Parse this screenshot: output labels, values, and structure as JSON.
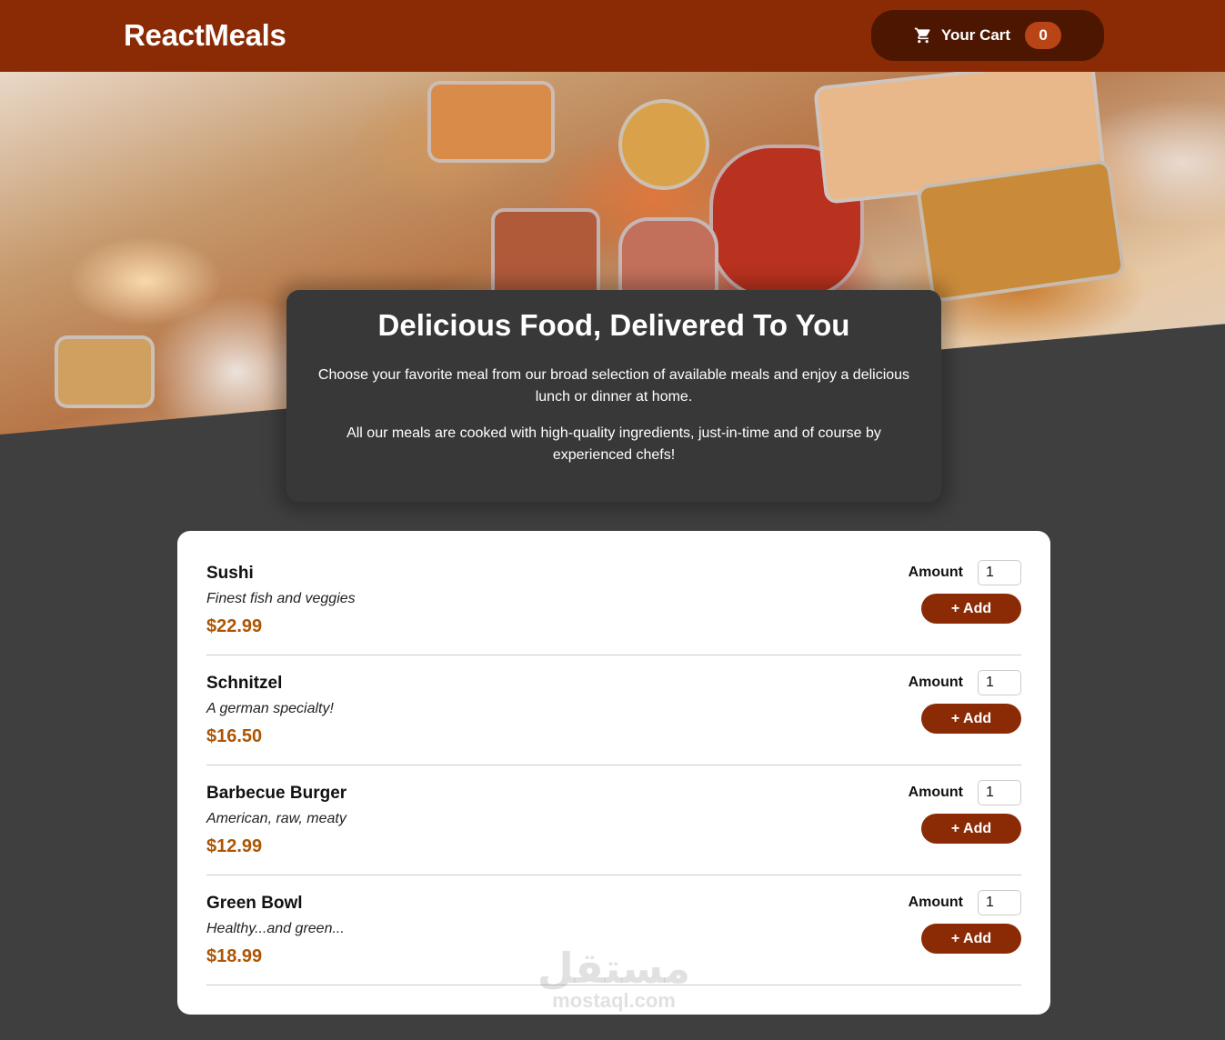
{
  "header": {
    "brand": "ReactMeals",
    "cart_label": "Your Cart",
    "cart_count": "0",
    "cart_icon": "cart-icon"
  },
  "summary": {
    "title": "Delicious Food, Delivered To You",
    "paragraph1": "Choose your favorite meal from our broad selection of available meals and enjoy a delicious lunch or dinner at home.",
    "paragraph2": "All our meals are cooked with high-quality ingredients, just-in-time and of course by experienced chefs!"
  },
  "meals": {
    "amount_label": "Amount",
    "add_label": "+ Add",
    "items": [
      {
        "name": "Sushi",
        "description": "Finest fish and veggies",
        "price": "$22.99",
        "amount": "1"
      },
      {
        "name": "Schnitzel",
        "description": "A german specialty!",
        "price": "$16.50",
        "amount": "1"
      },
      {
        "name": "Barbecue Burger",
        "description": "American, raw, meaty",
        "price": "$12.99",
        "amount": "1"
      },
      {
        "name": "Green Bowl",
        "description": "Healthy...and green...",
        "price": "$18.99",
        "amount": "1"
      }
    ]
  },
  "watermark": {
    "arabic": "مستقل",
    "latin": "mostaql.com"
  },
  "colors": {
    "header_bg": "#8a2b06",
    "cart_button_bg": "#4d1601",
    "cart_badge_bg": "#b94517",
    "page_bg": "#3f3f3f",
    "summary_bg": "#383838",
    "price_color": "#ad5502"
  }
}
